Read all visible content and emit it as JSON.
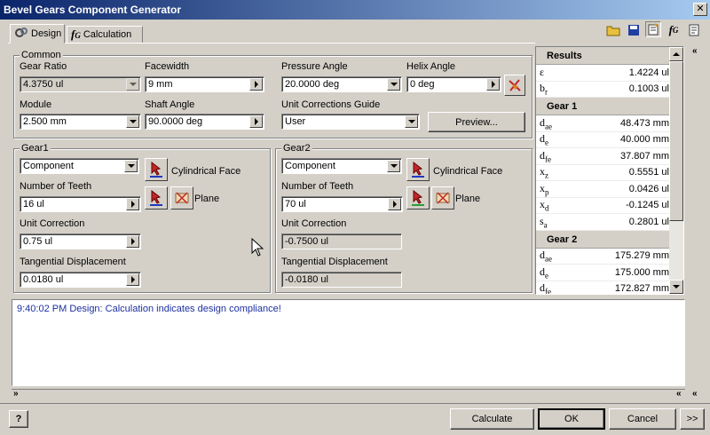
{
  "window": {
    "title": "Bevel Gears Component Generator",
    "close_label": "✕"
  },
  "tabs": [
    {
      "label": "Design"
    },
    {
      "label": "Calculation"
    }
  ],
  "common": {
    "legend": "Common",
    "gear_ratio": {
      "label": "Gear Ratio",
      "value": "4.3750 ul"
    },
    "facewidth": {
      "label": "Facewidth",
      "value": "9 mm"
    },
    "pressure_angle": {
      "label": "Pressure Angle",
      "value": "20.0000 deg"
    },
    "helix_angle": {
      "label": "Helix Angle",
      "value": "0 deg"
    },
    "module": {
      "label": "Module",
      "value": "2.500 mm"
    },
    "shaft_angle": {
      "label": "Shaft Angle",
      "value": "90.0000 deg"
    },
    "unit_corrections_guide": {
      "label": "Unit Corrections Guide",
      "value": "User"
    },
    "preview_button": "Preview..."
  },
  "gear1": {
    "legend": "Gear1",
    "type": "Component",
    "face_label": "Cylindrical Face",
    "teeth_label": "Number of Teeth",
    "teeth_value": "16 ul",
    "plane_label": "Plane",
    "unit_correction_label": "Unit Correction",
    "unit_correction_value": "0.75 ul",
    "tangential_label": "Tangential Displacement",
    "tangential_value": "0.0180 ul"
  },
  "gear2": {
    "legend": "Gear2",
    "type": "Component",
    "face_label": "Cylindrical Face",
    "teeth_label": "Number of Teeth",
    "teeth_value": "70 ul",
    "plane_label": "Plane",
    "unit_correction_label": "Unit Correction",
    "unit_correction_value": "-0.7500 ul",
    "tangential_label": "Tangential Displacement",
    "tangential_value": "-0.0180 ul"
  },
  "results": {
    "header": "Results",
    "general": [
      {
        "sym": "ε",
        "sub": "",
        "value": "1.4224 ul"
      },
      {
        "sym": "b",
        "sub": "r",
        "value": "0.1003 ul"
      }
    ],
    "gear1_header": "Gear 1",
    "gear1": [
      {
        "sym": "d",
        "sub": "ae",
        "value": "48.473 mm"
      },
      {
        "sym": "d",
        "sub": "e",
        "value": "40.000 mm"
      },
      {
        "sym": "d",
        "sub": "fe",
        "value": "37.807 mm"
      },
      {
        "sym": "x",
        "sub": "z",
        "value": "0.5551 ul"
      },
      {
        "sym": "x",
        "sub": "p",
        "value": "0.0426 ul"
      },
      {
        "sym": "x",
        "sub": "d",
        "value": "-0.1245 ul"
      },
      {
        "sym": "s",
        "sub": "a",
        "value": "0.2801 ul"
      }
    ],
    "gear2_header": "Gear 2",
    "gear2": [
      {
        "sym": "d",
        "sub": "ae",
        "value": "175.279 mm"
      },
      {
        "sym": "d",
        "sub": "e",
        "value": "175.000 mm"
      },
      {
        "sym": "d",
        "sub": "fe",
        "value": "172.827 mm"
      }
    ]
  },
  "message": "9:40:02 PM Design: Calculation indicates design compliance!",
  "footer": {
    "calculate": "Calculate",
    "ok": "OK",
    "cancel": "Cancel",
    "more": ">>",
    "help": "?"
  },
  "colors": {
    "accent": "#0a246a",
    "message_text": "#1c2fa0",
    "pick_red": "#c0282a",
    "pick_green": "#2a9c3a",
    "pick_blue": "#2038c0"
  }
}
